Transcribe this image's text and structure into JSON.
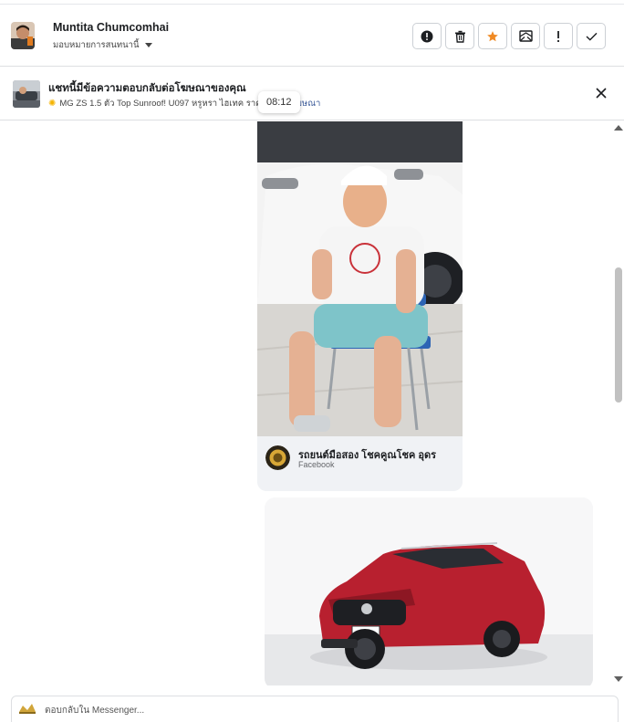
{
  "conversation": {
    "contact_name": "Muntita Chumcomhai",
    "assign_label": "มอบหมายการสนทนานี้"
  },
  "actions": [
    {
      "icon": "alert-circle-icon"
    },
    {
      "icon": "trash-icon"
    },
    {
      "icon": "star-icon"
    },
    {
      "icon": "mail-icon"
    },
    {
      "icon": "exclamation-icon"
    },
    {
      "icon": "check-icon"
    }
  ],
  "ad_banner": {
    "title": "แชทนี้มีข้อความตอบกลับต่อโฆษณาของคุณ",
    "subtitle": "MG ZS 1.5 ตัว Top Sunroof! U097 หรูหรา ไฮเทค ราคาดี",
    "link": "... ดูโฆษณา",
    "timestamp": "08:12"
  },
  "messages": {
    "shared_post": {
      "page_name": "รถยนต์มือสอง โชคคูณโชค อุดร",
      "source": "Facebook"
    }
  },
  "composer": {
    "placeholder": "ตอบกลับใน Messenger..."
  },
  "colors": {
    "star": "#f08a24",
    "link": "#385898",
    "border": "#ccd0d5"
  }
}
